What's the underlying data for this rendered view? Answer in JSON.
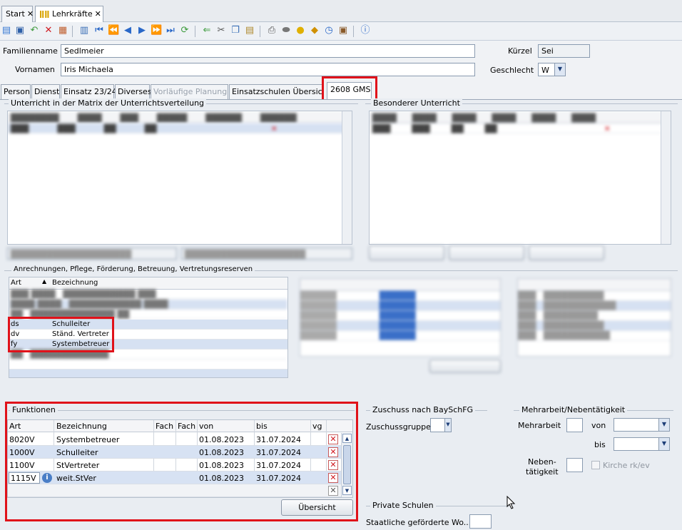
{
  "doc_tabs": [
    {
      "label": "Start"
    },
    {
      "label": "Lehrkräfte"
    }
  ],
  "toolbar": {
    "icons": [
      "new-icon",
      "save-icon",
      "undo-icon",
      "delete-icon",
      "properties-icon",
      "view-icon",
      "first-icon",
      "prev-page-icon",
      "prev-icon",
      "next-icon",
      "next-page-icon",
      "last-icon",
      "refresh-icon",
      "back-icon",
      "cut-icon",
      "copy-icon",
      "paste-icon",
      "print-icon",
      "preview-icon",
      "bulb-icon",
      "eraser-icon",
      "clock-icon",
      "person-icon",
      "help-icon"
    ]
  },
  "form": {
    "familienname_label": "Familienname",
    "familienname_value": "Sedlmeier",
    "vornamen_label": "Vornamen",
    "vornamen_value": "Iris Michaela",
    "kuerzel_label": "Kürzel",
    "kuerzel_value": "Sei",
    "geschlecht_label": "Geschlecht",
    "geschlecht_value": "W"
  },
  "form_tabs": [
    {
      "label": "Person"
    },
    {
      "label": "Dienst"
    },
    {
      "label": "Einsatz 23/24"
    },
    {
      "label": "Diverses"
    },
    {
      "label": "Vorläufige Planung"
    },
    {
      "label": "Einsatzschulen Übersicht"
    },
    {
      "label": "2608 GMS"
    }
  ],
  "groups": {
    "matrix_title": "Unterricht in der Matrix der Unterrichtsverteilung",
    "besonderer_title": "Besonderer Unterricht",
    "anrechnungen_title": "Anrechnungen, Pflege, Förderung, Betreuung, Vertretungsreserven",
    "funktionen_title": "Funktionen",
    "zuschuss_title": "Zuschuss nach BaySchFG",
    "mehrarbeit_title": "Mehrarbeit/Nebentätigkeit",
    "private_title": "Private Schulen"
  },
  "anrechnungen": {
    "columns": [
      "Art",
      "Bezeichnung"
    ],
    "rows": [
      {
        "art": "ds",
        "bez": "Schulleiter"
      },
      {
        "art": "dv",
        "bez": "Ständ. Vertreter"
      },
      {
        "art": "fy",
        "bez": "Systembetreuer"
      }
    ]
  },
  "funktionen": {
    "columns": [
      "Art",
      "Bezeichnung",
      "Fach",
      "Fach",
      "von",
      "bis",
      "vg"
    ],
    "rows": [
      {
        "art": "8020V",
        "bez": "Systembetreuer",
        "von": "01.08.2023",
        "bis": "31.07.2024"
      },
      {
        "art": "1000V",
        "bez": "Schulleiter",
        "von": "01.08.2023",
        "bis": "31.07.2024"
      },
      {
        "art": "1100V",
        "bez": "StVertreter",
        "von": "01.08.2023",
        "bis": "31.07.2024"
      },
      {
        "art": "1115V",
        "bez": "weit.StVer",
        "von": "01.08.2023",
        "bis": "31.07.2024"
      }
    ],
    "button": "Übersicht"
  },
  "zuschuss": {
    "gruppe_label": "Zuschussgruppe"
  },
  "mehrarbeit": {
    "mehrarbeit_label": "Mehrarbeit",
    "von_label": "von",
    "bis_label": "bis",
    "neben_label_1": "Neben-",
    "neben_label_2": "tätigkeit",
    "kirche_label": "Kirche rk/ev"
  },
  "private": {
    "label": "Staatliche geförderte Wo..."
  }
}
